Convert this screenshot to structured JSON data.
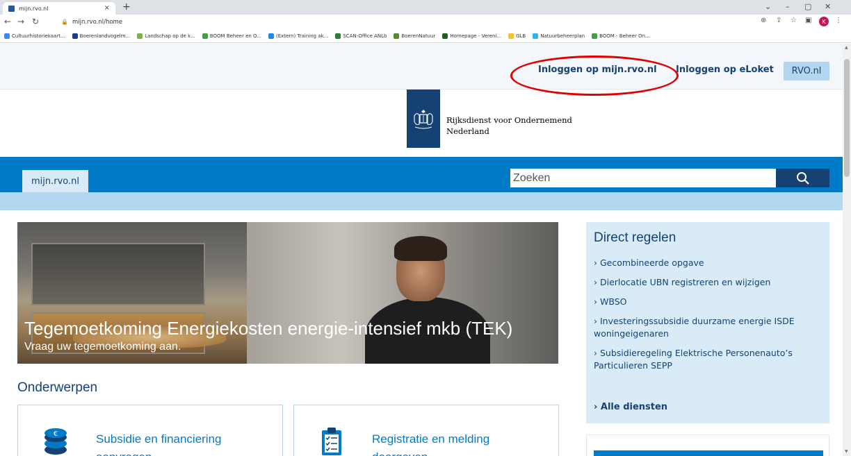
{
  "browser": {
    "tab_title": "mijn.rvo.nl",
    "tab_close": "×",
    "new_tab": "+",
    "url": "mijn.rvo.nl/home",
    "profile_initial": "K",
    "bookmarks": [
      {
        "label": "Cultuurhistoriekaart...",
        "color": "#4285f4"
      },
      {
        "label": "Boerenlandvogelm...",
        "color": "#1a3c8c"
      },
      {
        "label": "Landschap op de k...",
        "color": "#7cb342"
      },
      {
        "label": "BOOM Beheer en O...",
        "color": "#43a047"
      },
      {
        "label": "(Extern) Training ak...",
        "color": "#1e88e5"
      },
      {
        "label": "SCAN-Office ANLb",
        "color": "#2e7d32"
      },
      {
        "label": "BoerenNatuur",
        "color": "#558b2f"
      },
      {
        "label": "Homepage - Vereni...",
        "color": "#1b5e20"
      },
      {
        "label": "GLB",
        "color": "#fbc02d"
      },
      {
        "label": "Natuurbeheerplan",
        "color": "#29b6f6"
      },
      {
        "label": "BOOM - Beheer On...",
        "color": "#43a047"
      }
    ]
  },
  "header": {
    "login_mijn": "Inloggen op mijn.rvo.nl",
    "login_eloket": "Inloggen op eLoket",
    "rvo_button": "RVO.nl",
    "org_line1": "Rijksdienst voor Ondernemend",
    "org_line2": "Nederland"
  },
  "nav": {
    "site_tab": "mijn.rvo.nl",
    "search_placeholder": "Zoeken"
  },
  "hero": {
    "title": "Tegemoetkoming Energiekosten energie-intensief mkb (TEK)",
    "subtitle": "Vraag uw tegemoetkoming aan."
  },
  "topics": {
    "heading": "Onderwerpen",
    "cards": [
      {
        "title": "Subsidie en financiering aanvragen"
      },
      {
        "title": "Registratie en melding doorgeven"
      }
    ]
  },
  "sidebar": {
    "heading": "Direct regelen",
    "items": [
      {
        "label": "Gecombineerde opgave"
      },
      {
        "label": "Dierlocatie UBN registreren en wijzigen"
      },
      {
        "label": "WBSO"
      },
      {
        "label": "Investeringssubsidie duurzame energie ISDE woningeigenaren"
      },
      {
        "label": "Subsidieregeling Elektrische Personenauto’s Particulieren SEPP"
      }
    ],
    "all_services": "Alle diensten"
  },
  "colors": {
    "brand_dark": "#154273",
    "brand_blue": "#007bc7",
    "light_blue": "#b2d7ee",
    "sidebar_bg": "#d9ebf7",
    "highlight_ellipse": "#e00000"
  }
}
